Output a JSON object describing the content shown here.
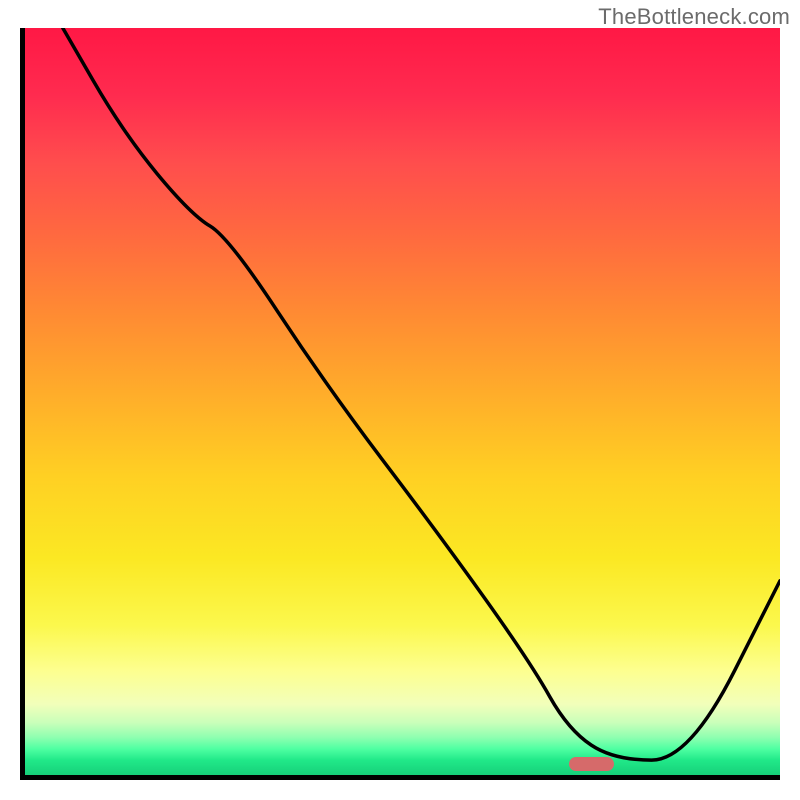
{
  "watermark": "TheBottleneck.com",
  "chart_data": {
    "type": "line",
    "title": "",
    "xlabel": "",
    "ylabel": "",
    "xlim": [
      0,
      100
    ],
    "ylim": [
      0,
      100
    ],
    "x": [
      5,
      13,
      22,
      27,
      40,
      55,
      67,
      72,
      78,
      88,
      100
    ],
    "values": [
      100,
      86,
      75,
      72,
      52,
      32,
      15,
      6,
      2,
      2,
      26
    ],
    "annotations": [
      {
        "type": "marker",
        "x": 75,
        "y": 1.5,
        "color": "#d66a6a"
      }
    ]
  },
  "colors": {
    "curve": "#000000",
    "axis": "#000000",
    "marker": "#d66a6a"
  }
}
